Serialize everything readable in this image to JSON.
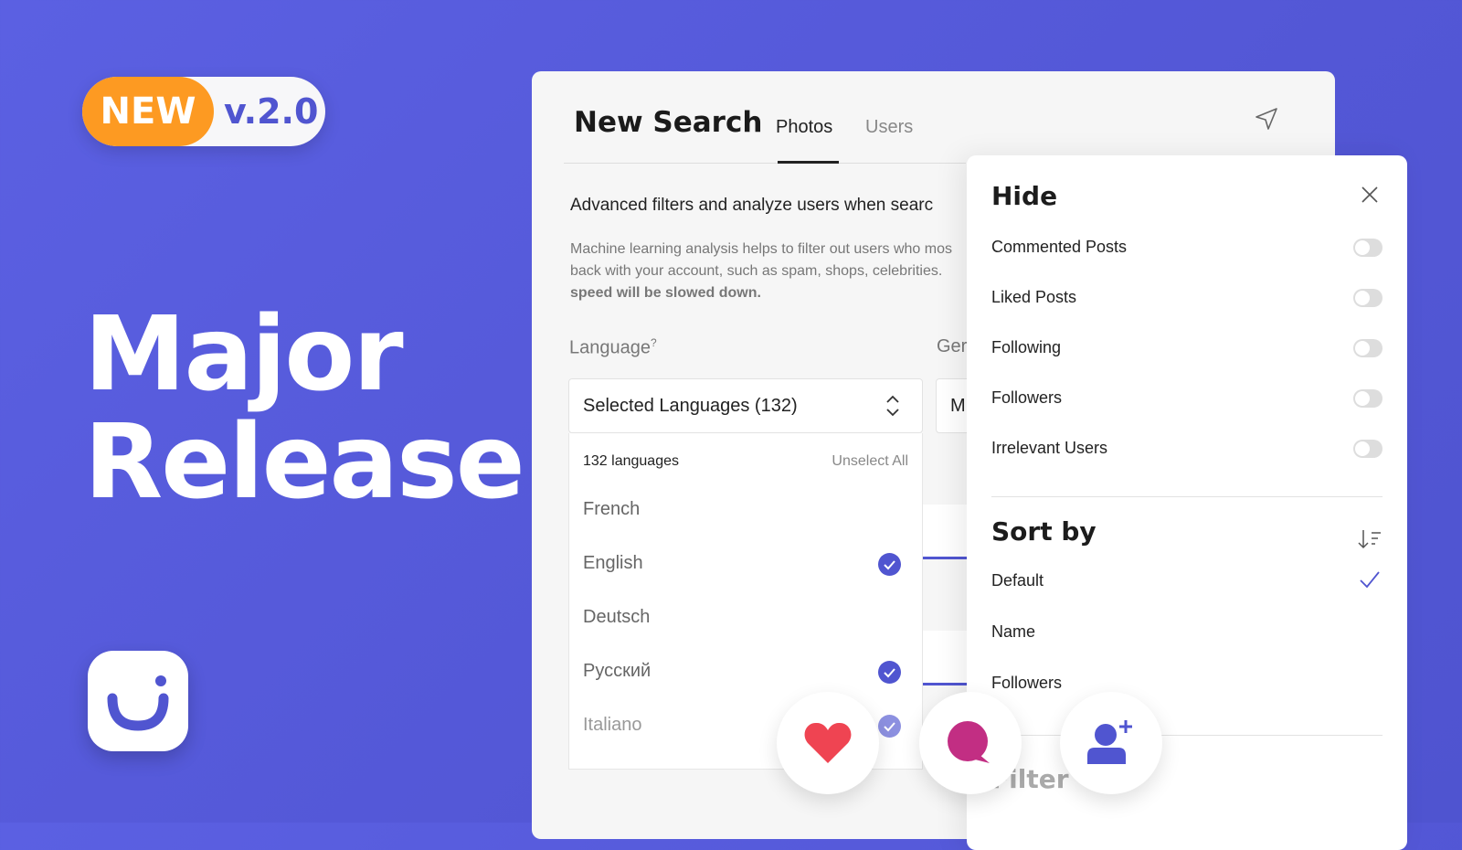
{
  "badge": {
    "new": "NEW",
    "version": "v.2.0"
  },
  "hero": {
    "line1": "Major",
    "line2": "Release"
  },
  "card": {
    "title": "New Search",
    "tabs": [
      "Photos",
      "Users"
    ],
    "active_tab": "Photos",
    "headline": "Advanced filters and analyze users when searc",
    "desc": [
      "Machine learning analysis helps to filter out users who mos",
      "back with your account, such as spam, shops, celebrities.",
      "speed will be slowed down."
    ],
    "language_label": "Language",
    "language_help": "?",
    "gender_label_partial": "Ger",
    "gender_value_partial": "M",
    "select_value": "Selected Languages (132)",
    "count_label": "132 languages",
    "unselect_all": "Unselect All",
    "languages": [
      {
        "name": "French",
        "checked": false
      },
      {
        "name": "English",
        "checked": true
      },
      {
        "name": "Deutsch",
        "checked": false
      },
      {
        "name": "Русский",
        "checked": true
      },
      {
        "name": "Italiano",
        "checked": true
      }
    ]
  },
  "panel": {
    "hide_title": "Hide",
    "hide_items": [
      {
        "label": "Commented Posts",
        "on": false
      },
      {
        "label": "Liked Posts",
        "on": false
      },
      {
        "label": "Following",
        "on": false
      },
      {
        "label": "Followers",
        "on": false
      },
      {
        "label": "Irrelevant Users",
        "on": false
      }
    ],
    "sort_title": "Sort by",
    "sort_items": [
      "Default",
      "Name",
      "Followers"
    ],
    "sort_selected": "Default",
    "filter_title": "Filter"
  },
  "actions": [
    "heart-icon",
    "comment-icon",
    "add-user-icon"
  ],
  "colors": {
    "accent": "#5055d0",
    "orange": "#fd9a22",
    "heart": "#ef4452",
    "comment": "#c22e83"
  }
}
